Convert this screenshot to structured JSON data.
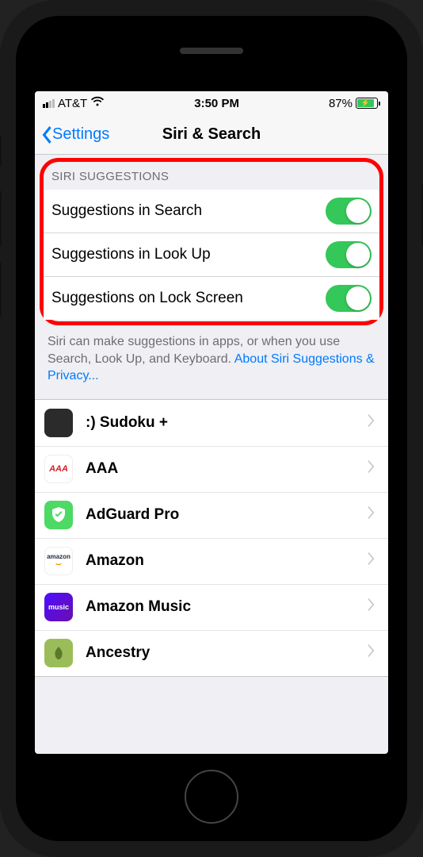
{
  "statusBar": {
    "carrier": "AT&T",
    "time": "3:50 PM",
    "batteryPercent": "87%"
  },
  "nav": {
    "back": "Settings",
    "title": "Siri & Search"
  },
  "siriSection": {
    "header": "SIRI SUGGESTIONS",
    "items": [
      {
        "label": "Suggestions in Search",
        "on": true
      },
      {
        "label": "Suggestions in Look Up",
        "on": true
      },
      {
        "label": "Suggestions on Lock Screen",
        "on": true
      }
    ],
    "footer": "Siri can make suggestions in apps, or when you use Search, Look Up, and Keyboard.",
    "link": "About Siri Suggestions & Privacy..."
  },
  "apps": [
    {
      "name": ":) Sudoku +",
      "iconClass": "icon-sudoku",
      "iconText": ""
    },
    {
      "name": "AAA",
      "iconClass": "icon-aaa",
      "iconText": "AAA"
    },
    {
      "name": "AdGuard Pro",
      "iconClass": "icon-adguard",
      "iconText": ""
    },
    {
      "name": "Amazon",
      "iconClass": "icon-amazon",
      "iconText": "amazon"
    },
    {
      "name": "Amazon Music",
      "iconClass": "icon-amazonmusic",
      "iconText": "music"
    },
    {
      "name": "Ancestry",
      "iconClass": "icon-ancestry",
      "iconText": ""
    }
  ]
}
